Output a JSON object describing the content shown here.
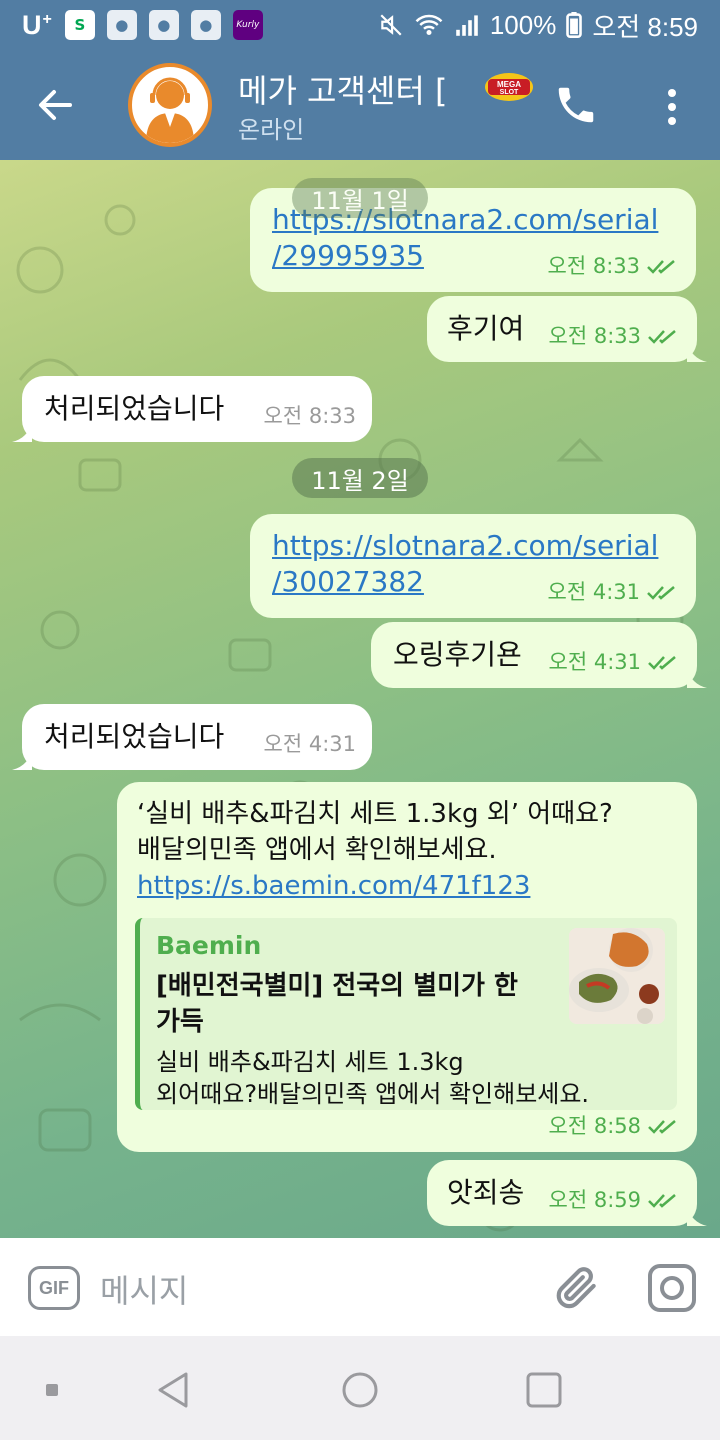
{
  "status_bar": {
    "carrier": "U",
    "carrier_plus": "+",
    "battery": "100%",
    "time": "오전 8:59",
    "apps": [
      "shinhan-icon",
      "message-icon",
      "message-icon",
      "message-icon",
      "kurly-icon"
    ]
  },
  "header": {
    "title": "메가 고객센터 [",
    "status": "온라인"
  },
  "messages": [
    {
      "type": "out",
      "link_line1": "https://slotnara2.com/serial",
      "link_line2": "/29995935",
      "time": "오전 8:33"
    },
    {
      "type": "out",
      "text": "후기여",
      "time": "오전 8:33"
    },
    {
      "type": "in",
      "text": "처리되었습니다",
      "time": "오전 8:33"
    },
    {
      "type": "date",
      "text": "11월 2일"
    },
    {
      "type": "out",
      "link_line1": "https://slotnara2.com/serial",
      "link_line2": "/30027382",
      "time": "오전 4:31"
    },
    {
      "type": "out",
      "text": "오링후기욘",
      "time": "오전 4:31"
    },
    {
      "type": "in",
      "text": "처리되었습니다",
      "time": "오전 4:31"
    },
    {
      "type": "out",
      "line1": "‘실비 배추&파김치 세트 1.3kg 외’ 어때요?",
      "line2": "배달의민족 앱에서 확인해보세요.",
      "link": "https://s.baemin.com/471f123",
      "time": "오전 8:58",
      "preview": {
        "site": "Baemin",
        "title": "[배민전국별미] 전국의 별미가 한가득",
        "desc_line1": "실비 배추&파김치 세트 1.3kg",
        "desc_line2": "외어때요?배달의민족 앱에서 확인해보세요."
      }
    },
    {
      "type": "out",
      "text": "앗죄송",
      "time": "오전 8:59"
    }
  ],
  "floating_date": "11월 1일",
  "input": {
    "gif_label": "GIF",
    "placeholder": "메시지"
  },
  "colors": {
    "header": "#527da3",
    "out_bubble": "#effedd",
    "in_bubble": "#ffffff",
    "accent_green": "#4fae4e",
    "link": "#2a78c5"
  }
}
